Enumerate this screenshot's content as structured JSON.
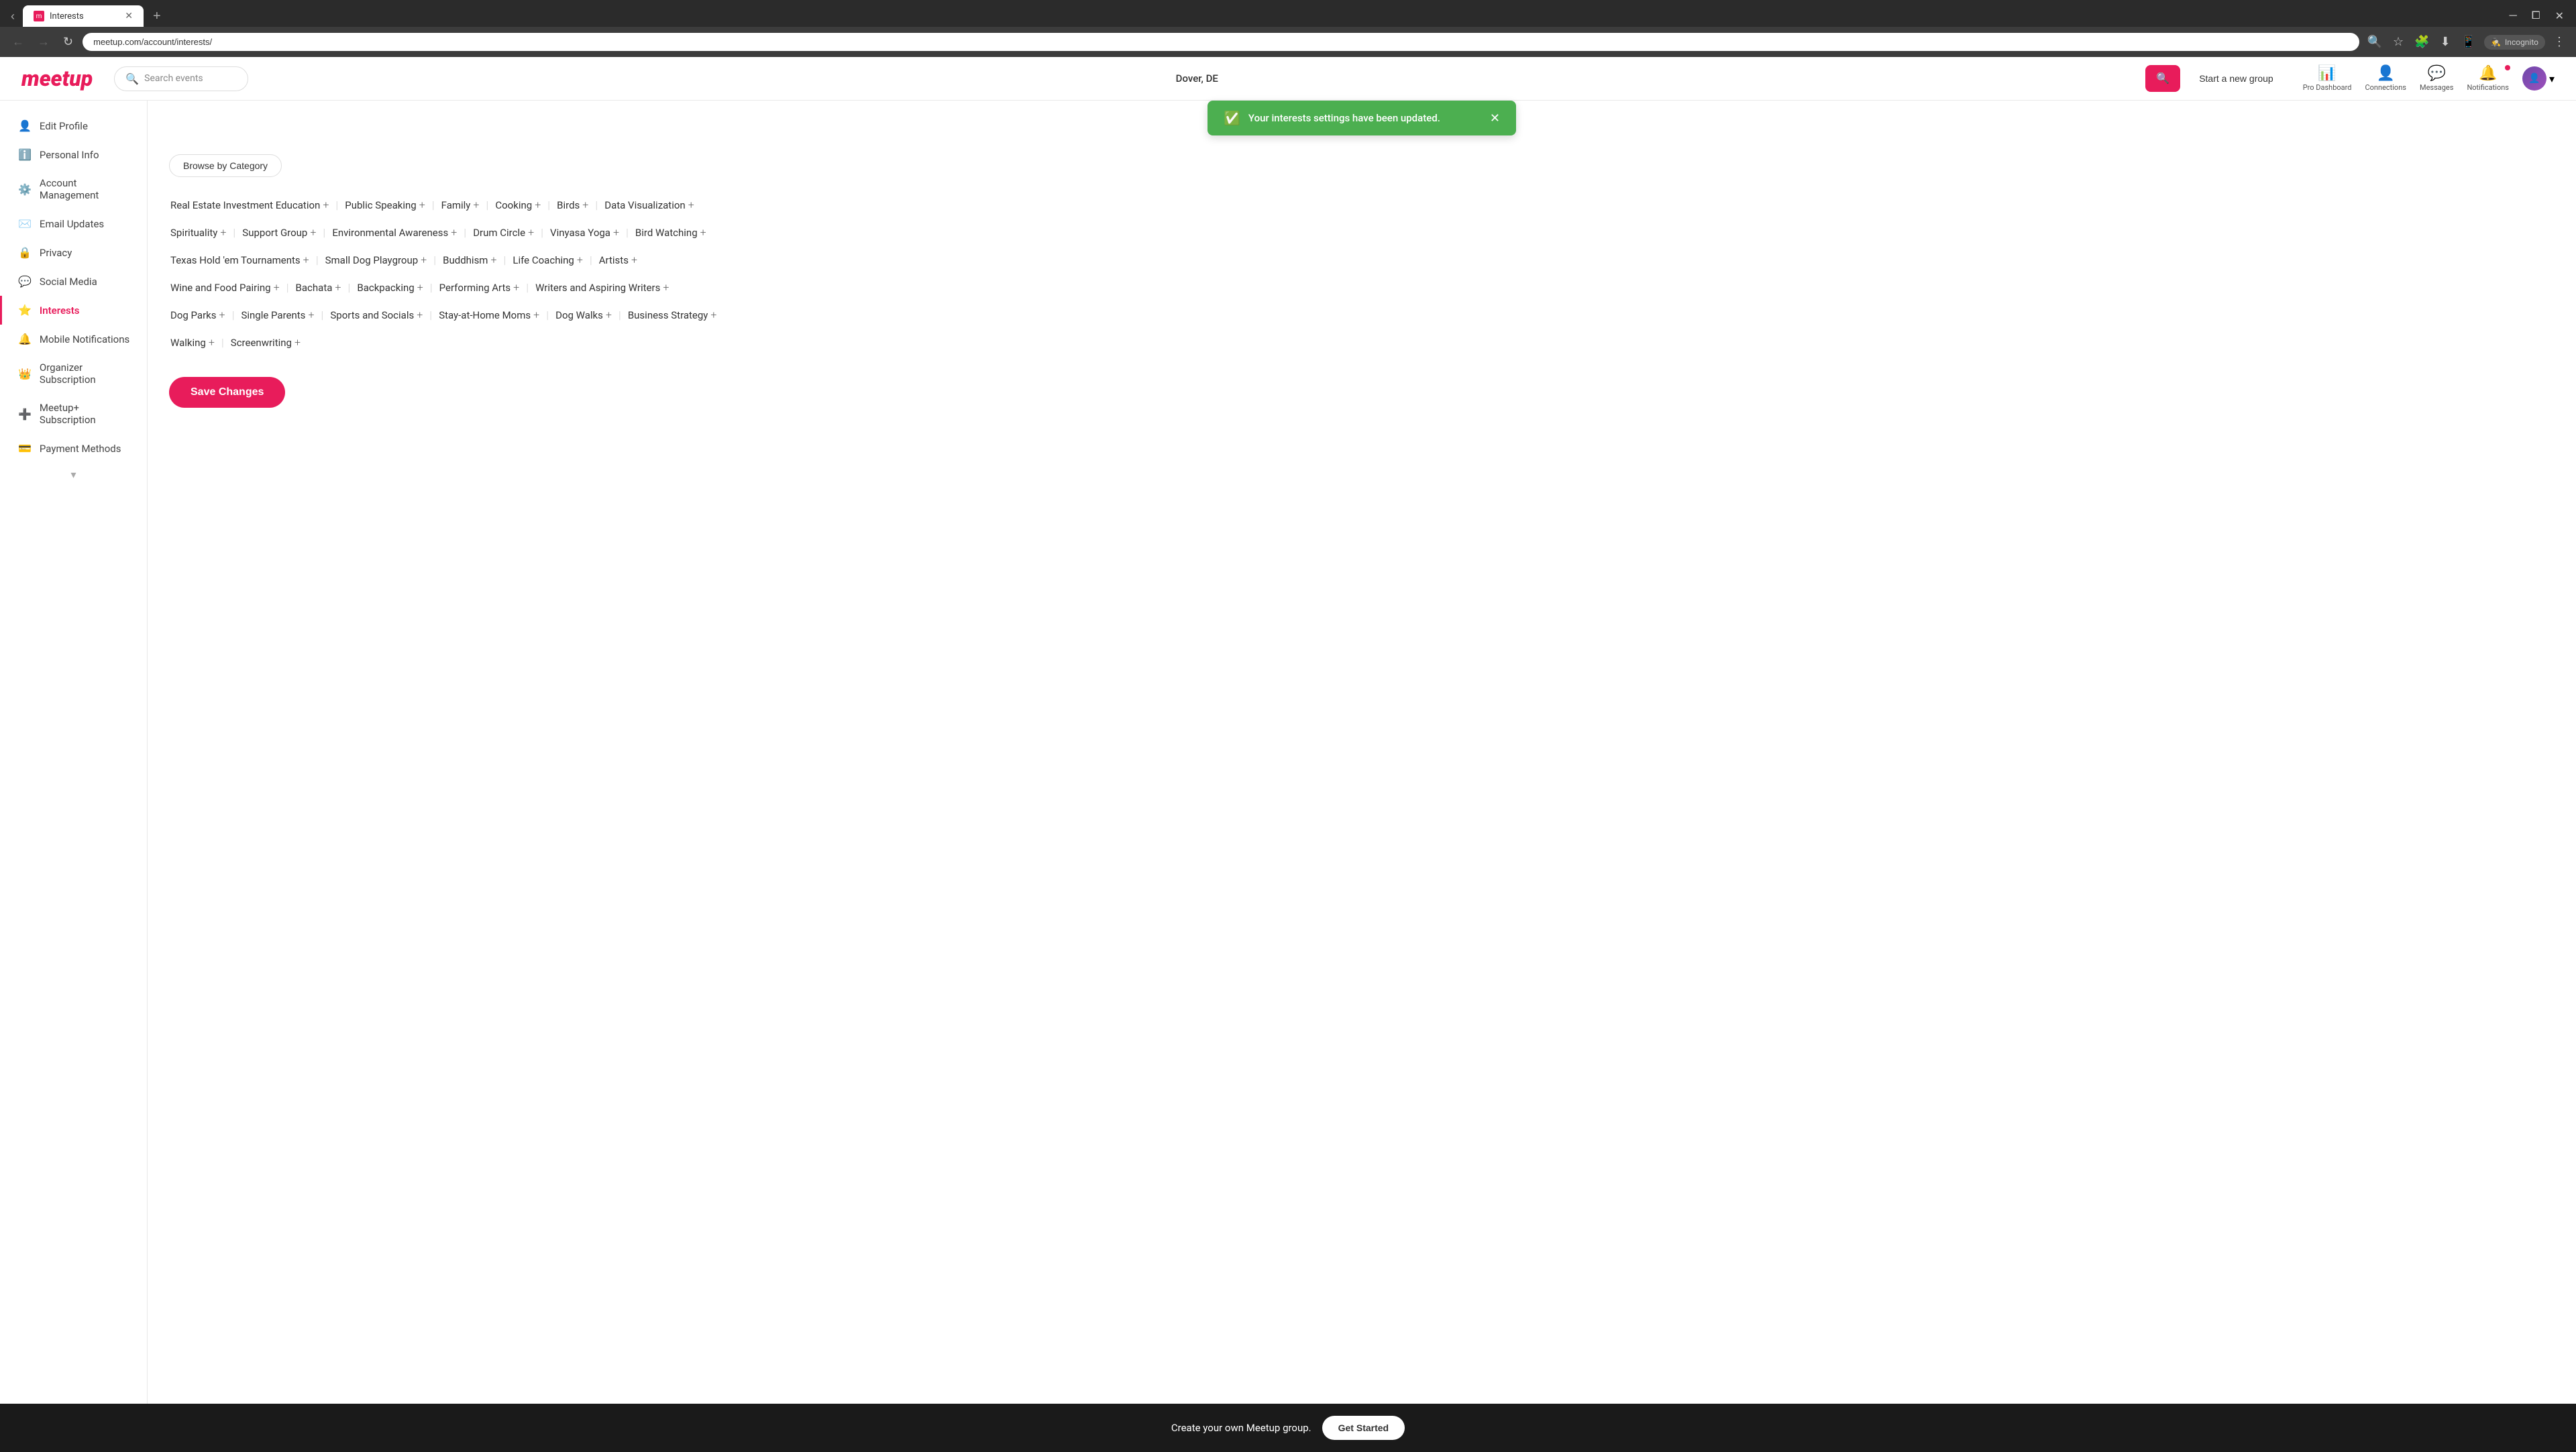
{
  "browser": {
    "tab_title": "Interests",
    "address": "meetup.com/account/interests/",
    "incognito_label": "Incognito"
  },
  "nav": {
    "logo": "meetup",
    "search_placeholder": "Search events",
    "location": "Dover, DE",
    "start_group": "Start a new group",
    "pro_dashboard": "Pro Dashboard",
    "connections": "Connections",
    "messages": "Messages",
    "notifications": "Notifications"
  },
  "sidebar": {
    "items": [
      {
        "id": "edit-profile",
        "icon": "👤",
        "label": "Edit Profile"
      },
      {
        "id": "personal-info",
        "icon": "ℹ️",
        "label": "Personal Info"
      },
      {
        "id": "account-management",
        "icon": "⚙️",
        "label": "Account Management"
      },
      {
        "id": "email-updates",
        "icon": "✉️",
        "label": "Email Updates"
      },
      {
        "id": "privacy",
        "icon": "🔒",
        "label": "Privacy"
      },
      {
        "id": "social-media",
        "icon": "💬",
        "label": "Social Media"
      },
      {
        "id": "interests",
        "icon": "⭐",
        "label": "Interests",
        "active": true
      },
      {
        "id": "mobile-notifications",
        "icon": "🔔",
        "label": "Mobile Notifications"
      },
      {
        "id": "organizer-subscription",
        "icon": "👑",
        "label": "Organizer Subscription"
      },
      {
        "id": "meetup-plus",
        "icon": "➕",
        "label": "Meetup+ Subscription"
      },
      {
        "id": "payment-methods",
        "icon": "💳",
        "label": "Payment Methods"
      }
    ]
  },
  "success_banner": {
    "message": "Your interests settings have been updated.",
    "check_icon": "✓"
  },
  "browse_btn": "Browse by Category",
  "interests": {
    "rows": [
      [
        {
          "label": "Real Estate Investment Education"
        },
        {
          "label": "Public Speaking"
        },
        {
          "label": "Family"
        },
        {
          "label": "Cooking"
        },
        {
          "label": "Birds"
        },
        {
          "label": "Data Visualization"
        }
      ],
      [
        {
          "label": "Spirituality"
        },
        {
          "label": "Support Group"
        },
        {
          "label": "Environmental Awareness"
        },
        {
          "label": "Drum Circle"
        },
        {
          "label": "Vinyasa Yoga"
        },
        {
          "label": "Bird Watching"
        }
      ],
      [
        {
          "label": "Texas Hold 'em Tournaments"
        },
        {
          "label": "Small Dog Playgroup"
        },
        {
          "label": "Buddhism"
        },
        {
          "label": "Life Coaching"
        },
        {
          "label": "Artists"
        }
      ],
      [
        {
          "label": "Wine and Food Pairing"
        },
        {
          "label": "Bachata"
        },
        {
          "label": "Backpacking"
        },
        {
          "label": "Performing Arts"
        },
        {
          "label": "Writers and Aspiring Writers"
        }
      ],
      [
        {
          "label": "Dog Parks"
        },
        {
          "label": "Single Parents"
        },
        {
          "label": "Sports and Socials"
        },
        {
          "label": "Stay-at-Home Moms"
        },
        {
          "label": "Dog Walks"
        },
        {
          "label": "Business Strategy"
        }
      ],
      [
        {
          "label": "Walking"
        },
        {
          "label": "Screenwriting"
        }
      ]
    ]
  },
  "save_btn": "Save Changes",
  "bottom_bar": {
    "text": "Create your own Meetup group.",
    "btn": "Get Started"
  }
}
